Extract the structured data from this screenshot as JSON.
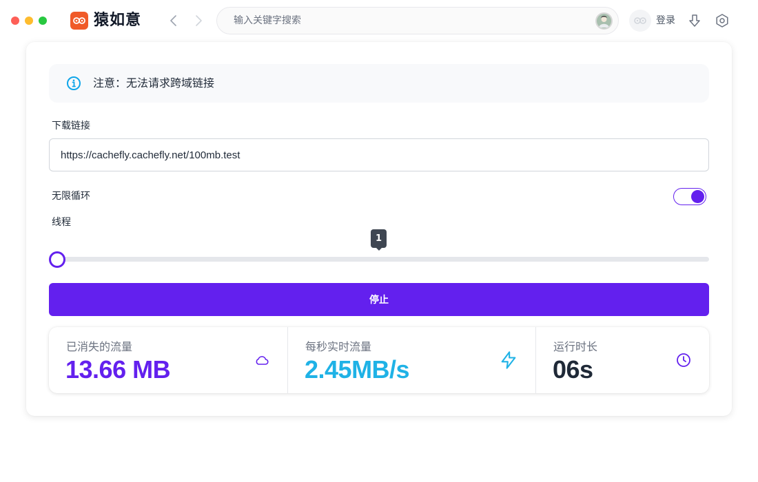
{
  "app": {
    "title": "猿如意",
    "brand_color": "#f05a28"
  },
  "titlebar": {
    "search_placeholder": "输入关键字搜索",
    "login_label": "登录"
  },
  "notice": {
    "text": "注意：无法请求跨域链接",
    "icon": "info-icon"
  },
  "form": {
    "url_label": "下载链接",
    "url_value": "https://cachefly.cachefly.net/100mb.test",
    "loop_label": "无限循环",
    "loop_enabled": true,
    "threads_label": "线程",
    "threads_value": "1",
    "threads_fraction": 0,
    "stop_label": "停止"
  },
  "stats": {
    "consumed": {
      "title": "已消失的流量",
      "value": "13.66 MB",
      "icon": "cloud-icon"
    },
    "rate": {
      "title": "每秒实时流量",
      "value": "2.45MB/s",
      "icon": "lightning-icon"
    },
    "runtime": {
      "title": "运行时长",
      "value": "06s",
      "icon": "clock-icon"
    }
  },
  "colors": {
    "accent": "#6320ee",
    "rate": "#1fb2e6"
  }
}
